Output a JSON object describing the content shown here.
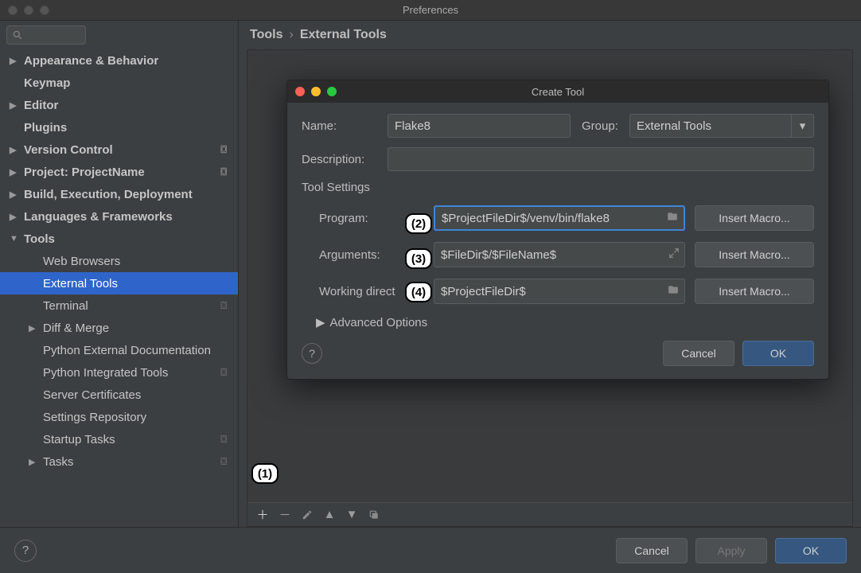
{
  "window_title": "Preferences",
  "sidebar": {
    "items": [
      {
        "label": "Appearance & Behavior",
        "bold": true,
        "arrow": "▶",
        "indent": 0
      },
      {
        "label": "Keymap",
        "bold": true,
        "arrow": "",
        "indent": 0
      },
      {
        "label": "Editor",
        "bold": true,
        "arrow": "▶",
        "indent": 0
      },
      {
        "label": "Plugins",
        "bold": true,
        "arrow": "",
        "indent": 0
      },
      {
        "label": "Version Control",
        "bold": true,
        "arrow": "▶",
        "indent": 0,
        "badge": "⌼"
      },
      {
        "label": "Project: ProjectName",
        "bold": true,
        "arrow": "▶",
        "indent": 0,
        "badge": "⌼"
      },
      {
        "label": "Build, Execution, Deployment",
        "bold": true,
        "arrow": "▶",
        "indent": 0
      },
      {
        "label": "Languages & Frameworks",
        "bold": true,
        "arrow": "▶",
        "indent": 0
      },
      {
        "label": "Tools",
        "bold": true,
        "arrow": "▼",
        "indent": 0
      },
      {
        "label": "Web Browsers",
        "bold": false,
        "arrow": "",
        "indent": 1
      },
      {
        "label": "External Tools",
        "bold": false,
        "arrow": "",
        "indent": 1,
        "selected": true
      },
      {
        "label": "Terminal",
        "bold": false,
        "arrow": "",
        "indent": 1,
        "badge": "⌼"
      },
      {
        "label": "Diff & Merge",
        "bold": false,
        "arrow": "▶",
        "indent": 1
      },
      {
        "label": "Python External Documentation",
        "bold": false,
        "arrow": "",
        "indent": 1
      },
      {
        "label": "Python Integrated Tools",
        "bold": false,
        "arrow": "",
        "indent": 1,
        "badge": "⌼"
      },
      {
        "label": "Server Certificates",
        "bold": false,
        "arrow": "",
        "indent": 1
      },
      {
        "label": "Settings Repository",
        "bold": false,
        "arrow": "",
        "indent": 1
      },
      {
        "label": "Startup Tasks",
        "bold": false,
        "arrow": "",
        "indent": 1,
        "badge": "⌼"
      },
      {
        "label": "Tasks",
        "bold": false,
        "arrow": "▶",
        "indent": 1,
        "badge": "⌼"
      }
    ]
  },
  "breadcrumb": {
    "root": "Tools",
    "current": "External Tools"
  },
  "dialog": {
    "title": "Create Tool",
    "name_label": "Name:",
    "name_value": "Flake8",
    "group_label": "Group:",
    "group_value": "External Tools",
    "desc_label": "Description:",
    "desc_value": "",
    "tool_settings_label": "Tool Settings",
    "advanced_label": "Advanced Options",
    "rows": {
      "program": {
        "label": "Program:",
        "value": "$ProjectFileDir$/venv/bin/flake8",
        "btn": "Insert Macro..."
      },
      "arguments": {
        "label": "Arguments:",
        "value": "$FileDir$/$FileName$",
        "btn": "Insert Macro..."
      },
      "workdir": {
        "label": "Working direct",
        "value": "$ProjectFileDir$",
        "btn": "Insert Macro..."
      }
    },
    "cancel": "Cancel",
    "ok": "OK"
  },
  "footer": {
    "cancel": "Cancel",
    "apply": "Apply",
    "ok": "OK"
  },
  "callouts": {
    "c1": "(1)",
    "c2": "(2)",
    "c3": "(3)",
    "c4": "(4)"
  }
}
